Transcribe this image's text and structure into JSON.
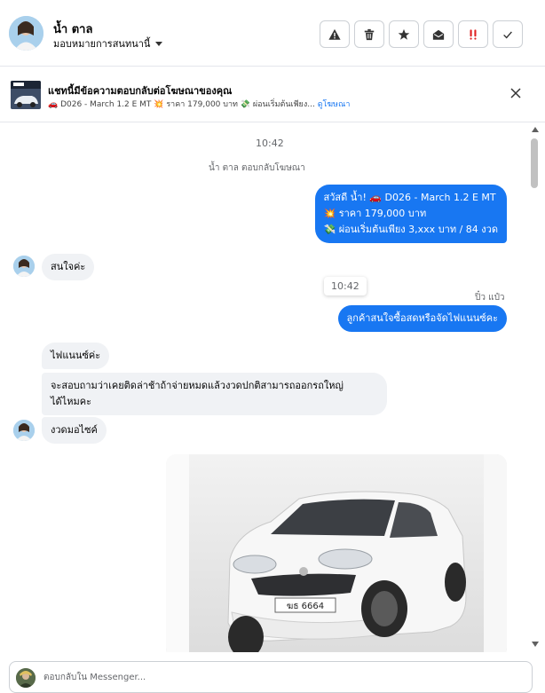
{
  "header": {
    "contact_name": "น้ำ ตาล",
    "assign_label": "มอบหมายการสนทนานี้",
    "actions": [
      {
        "name": "report-spam-button",
        "icon": "warning-icon"
      },
      {
        "name": "delete-button",
        "icon": "trash-icon"
      },
      {
        "name": "star-button",
        "icon": "star-icon"
      },
      {
        "name": "mark-unread-button",
        "icon": "envelope-open-icon"
      },
      {
        "name": "follow-up-button",
        "icon": "double-exclamation-icon"
      },
      {
        "name": "mark-done-button",
        "icon": "checkmark-icon"
      }
    ]
  },
  "ad_banner": {
    "title": "แชทนี้มีข้อความตอบกลับต่อโฆษณาของคุณ",
    "subtitle": "🚗 D026 - March 1.2 E MT 💥 ราคา 179,000 บาท 💸 ผ่อนเริ่มต้นเพียง...",
    "link_label": "ดูโฆษณา"
  },
  "chat": {
    "timestamp_top": "10:42",
    "system_note": "น้ำ ตาล ตอบกลับโฆษณา",
    "outgoing_ad_message": {
      "line1": "สวัสดี น้ำ! 🚗 D026 - March 1.2 E MT",
      "line2": "💥 ราคา 179,000 บาท",
      "line3": "💸 ผ่อนเริ่มต้นเพียง 3,xxx บาท / 84 งวด"
    },
    "incoming_1": "สนใจค่ะ",
    "hover_timestamp": "10:42",
    "sender_name": "ปิ๋ว แป๋ว",
    "outgoing_2": "ลูกค้าสนใจซื้อสดหรือจัดไฟแนนซ์คะ",
    "incoming_2": "ไฟแนนซ์ค่ะ",
    "incoming_3_line1": "จะสอบถามว่าเคยติดล่าช้าถ้าจ่ายหมดแล้วงวดปกติสามารถออกรถใหญ่",
    "incoming_3_line2": "ได้ไหมคะ",
    "incoming_4": "งวดมอไซค์",
    "photo_plate": "ฆธ 6664"
  },
  "reply": {
    "placeholder": "ตอบกลับใน Messenger..."
  },
  "colors": {
    "accent": "#1877f2",
    "incoming_bubble": "#f0f2f5",
    "follow_up_icon": "#e02020"
  }
}
